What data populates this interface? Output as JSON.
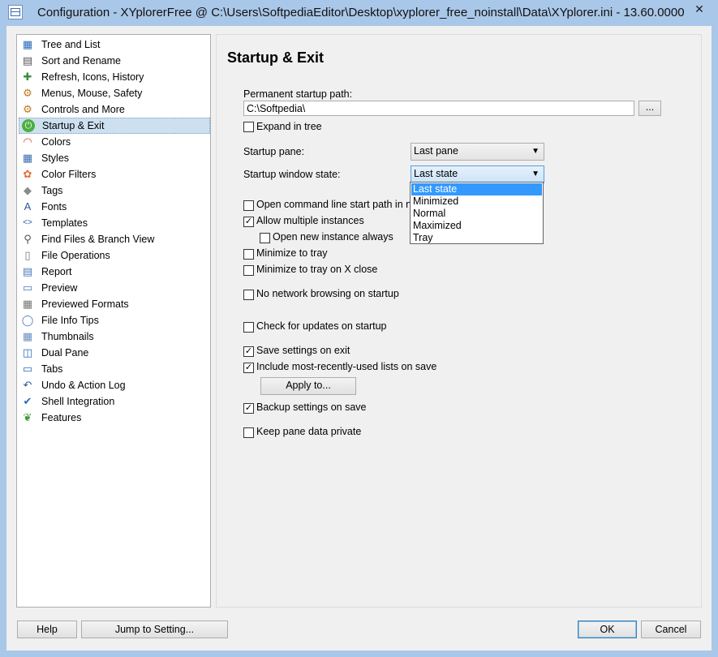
{
  "window": {
    "title": "Configuration - XYplorerFree @ C:\\Users\\SoftpediaEditor\\Desktop\\xyplorer_free_noinstall\\Data\\XYplorer.ini - 13.60.0000",
    "close_glyph": "✕"
  },
  "tree": {
    "items": [
      {
        "label": "Tree and List",
        "icon": "window-layout-icon"
      },
      {
        "label": "Sort and Rename",
        "icon": "sort-icon"
      },
      {
        "label": "Refresh, Icons, History",
        "icon": "refresh-icon"
      },
      {
        "label": "Menus, Mouse, Safety",
        "icon": "gear-icon"
      },
      {
        "label": "Controls and More",
        "icon": "gear-icon"
      },
      {
        "label": "Startup & Exit",
        "icon": "power-icon"
      },
      {
        "label": "Colors",
        "icon": "rainbow-icon"
      },
      {
        "label": "Styles",
        "icon": "grid-icon"
      },
      {
        "label": "Color Filters",
        "icon": "flower-icon"
      },
      {
        "label": "Tags",
        "icon": "tag-icon"
      },
      {
        "label": "Fonts",
        "icon": "font-icon"
      },
      {
        "label": "Templates",
        "icon": "code-icon"
      },
      {
        "label": "Find Files & Branch View",
        "icon": "search-icon"
      },
      {
        "label": "File Operations",
        "icon": "document-icon"
      },
      {
        "label": "Report",
        "icon": "report-icon"
      },
      {
        "label": "Preview",
        "icon": "preview-icon"
      },
      {
        "label": "Previewed Formats",
        "icon": "preview-formats-icon"
      },
      {
        "label": "File Info Tips",
        "icon": "speech-bubble-icon"
      },
      {
        "label": "Thumbnails",
        "icon": "thumbnails-icon"
      },
      {
        "label": "Dual Pane",
        "icon": "dual-pane-icon"
      },
      {
        "label": "Tabs",
        "icon": "tabs-icon"
      },
      {
        "label": "Undo & Action Log",
        "icon": "undo-icon"
      },
      {
        "label": "Shell Integration",
        "icon": "checkmark-icon"
      },
      {
        "label": "Features",
        "icon": "leaf-icon"
      }
    ],
    "selected": "Startup & Exit"
  },
  "panel": {
    "heading": "Startup & Exit",
    "startup_path_label": "Permanent startup path:",
    "startup_path_value": "C:\\Softpedia\\",
    "browse_label": "...",
    "expand_in_tree": {
      "label": "Expand in tree",
      "checked": false
    },
    "startup_pane_label": "Startup pane:",
    "startup_pane_value": "Last pane",
    "window_state_label": "Startup window state:",
    "window_state_value": "Last state",
    "window_state_options": [
      "Last state",
      "Minimized",
      "Normal",
      "Maximized",
      "Tray"
    ],
    "open_cmd": {
      "label": "Open command line start path in ne",
      "checked": false
    },
    "allow_multiple": {
      "label": "Allow multiple instances",
      "checked": true
    },
    "open_new_instance": {
      "label": "Open new instance always",
      "checked": false
    },
    "minimize_tray": {
      "label": "Minimize to tray",
      "checked": false
    },
    "minimize_tray_close": {
      "label": "Minimize to tray on X close",
      "checked": false
    },
    "no_network": {
      "label": "No network browsing on startup",
      "checked": false
    },
    "check_updates": {
      "label": "Check for updates on startup",
      "checked": false
    },
    "save_settings": {
      "label": "Save settings on exit",
      "checked": true
    },
    "include_mru": {
      "label": "Include most-recently-used lists on save",
      "checked": true
    },
    "apply_to_label": "Apply to...",
    "backup_settings": {
      "label": "Backup settings on save",
      "checked": true
    },
    "keep_private": {
      "label": "Keep pane data private",
      "checked": false
    }
  },
  "footer": {
    "help_label": "Help",
    "jump_label": "Jump to Setting...",
    "ok_label": "OK",
    "cancel_label": "Cancel"
  },
  "colors": {
    "title_bar": "#a9c7e8",
    "selection": "#cde0f0",
    "dropdown_highlight": "#3399ff"
  }
}
